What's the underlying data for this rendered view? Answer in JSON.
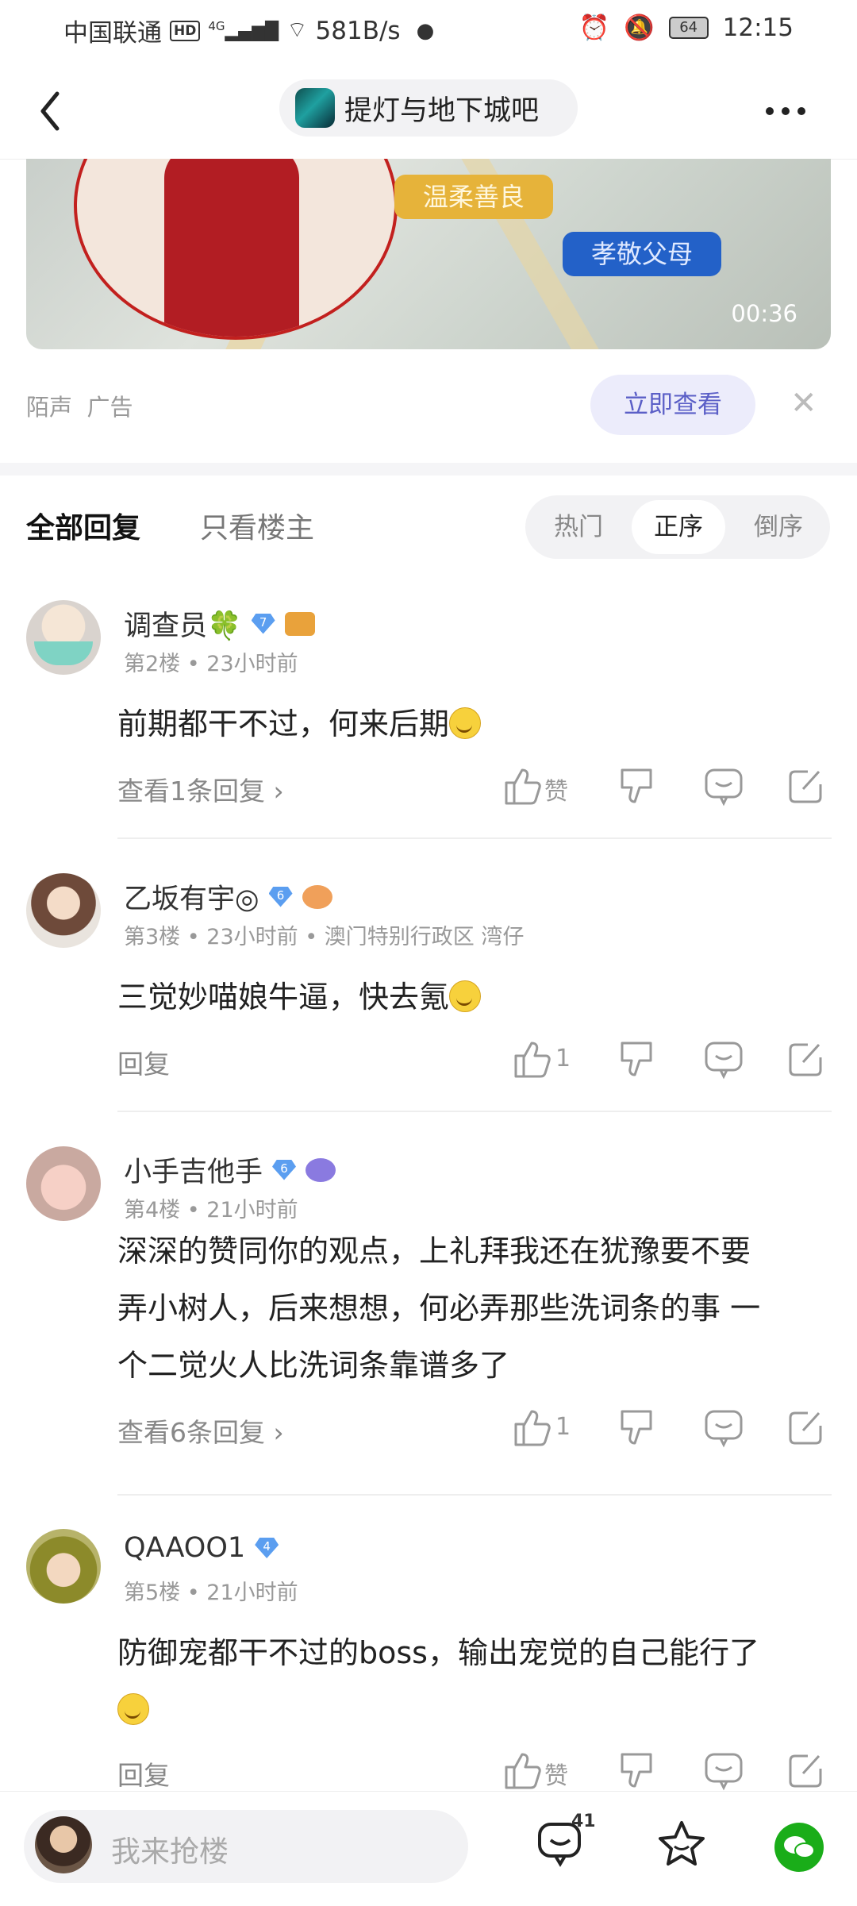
{
  "status_bar": {
    "carrier": "中国联通",
    "hd": "HD",
    "network": "4G",
    "speed": "581B/s",
    "battery": "64",
    "time": "12:15"
  },
  "nav": {
    "back_icon": "chevron-left-icon",
    "title": "提灯与地下城吧",
    "more_icon": "more-icon"
  },
  "ad": {
    "tag1": "温柔善良",
    "tag2": "孝敬父母",
    "duration": "00:36",
    "source": "陌声",
    "ad_label": "广告",
    "cta": "立即查看",
    "close": "✕"
  },
  "tabs": {
    "all": "全部回复",
    "op_only": "只看楼主",
    "sort_hot": "热门",
    "sort_asc": "正序",
    "sort_desc": "倒序",
    "active_sort": "正序"
  },
  "posts": [
    {
      "username": "调查员🍀",
      "level": "7",
      "floor": "第2楼",
      "time": "23小时前",
      "location": "",
      "content": "前期都干不过，何来后期",
      "reply_link": "查看1条回复 ›",
      "likes": "赞"
    },
    {
      "username": "乙坂有宇◎",
      "level": "6",
      "floor": "第3楼",
      "time": "23小时前",
      "location": "澳门特别行政区 湾仔",
      "content": "三觉妙喵娘牛逼，快去氪",
      "reply_link": "回复",
      "likes": "1"
    },
    {
      "username": "小手吉他手",
      "level": "6",
      "floor": "第4楼",
      "time": "21小时前",
      "location": "",
      "content_lines": [
        "深深的赞同你的观点，上礼拜我还在犹豫要不要",
        "弄小树人，后来想想，何必弄那些洗词条的事 一",
        "个二觉火人比洗词条靠谱多了"
      ],
      "reply_link": "查看6条回复 ›",
      "likes": "1"
    },
    {
      "username": "QAAOO1",
      "level": "4",
      "floor": "第5楼",
      "time": "21小时前",
      "location": "",
      "content": "防御宠都干不过的boss，输出宠觉的自己能行了",
      "reply_link": "回复",
      "likes": "赞"
    }
  ],
  "bottom": {
    "input_placeholder": "我来抢楼",
    "comment_count": "41"
  },
  "colors": {
    "accent": "#5b5fc7",
    "level_badge": "#5b9ef0",
    "wechat": "#1aad19"
  }
}
